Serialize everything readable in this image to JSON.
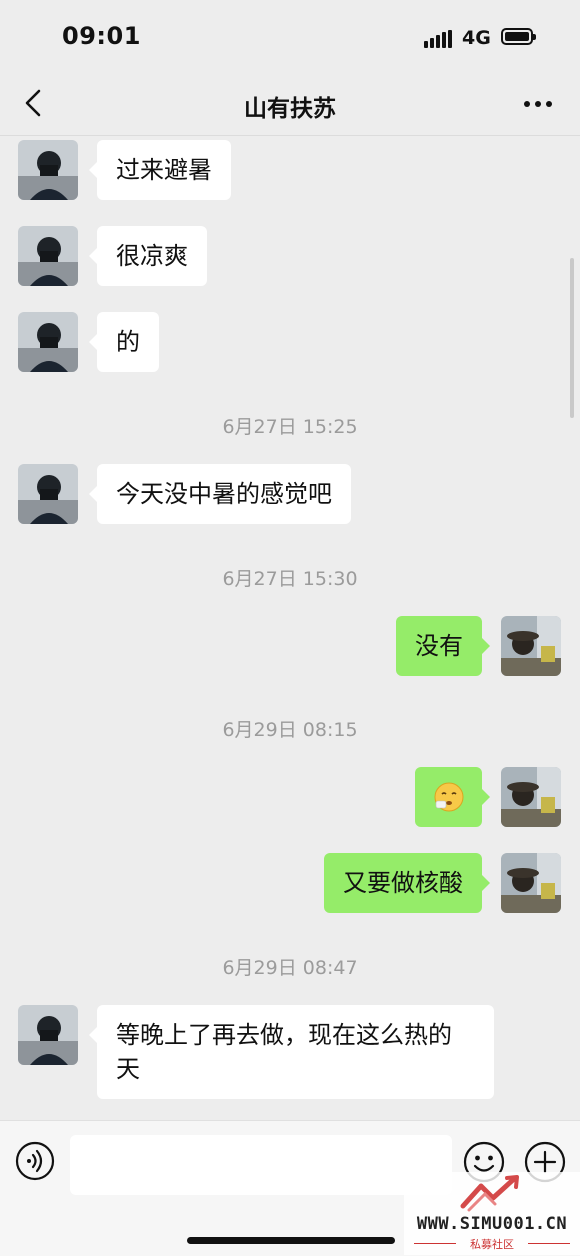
{
  "status_bar": {
    "time": "09:01",
    "network": "4G"
  },
  "header": {
    "title": "山有扶苏"
  },
  "messages": [
    {
      "side": "in",
      "text": "过来避暑"
    },
    {
      "side": "in",
      "text": "很凉爽"
    },
    {
      "side": "in",
      "text": "的"
    },
    {
      "type": "timestamp",
      "text": "6月27日 15:25"
    },
    {
      "side": "in",
      "text": "今天没中暑的感觉吧"
    },
    {
      "type": "timestamp",
      "text": "6月27日 15:30"
    },
    {
      "side": "out",
      "text": "没有"
    },
    {
      "type": "timestamp",
      "text": "6月29日 08:15"
    },
    {
      "side": "out",
      "type": "sticker",
      "emoji": "🤥"
    },
    {
      "side": "out",
      "text": "又要做核酸"
    },
    {
      "type": "timestamp",
      "text": "6月29日 08:47"
    },
    {
      "side": "in",
      "text": "等晚上了再去做，现在这么热的天"
    }
  ],
  "input_bar": {
    "value": "",
    "placeholder": ""
  },
  "watermark": {
    "text": "WWW.SIMU001.CN",
    "subtext": "私募社区"
  },
  "colors": {
    "background": "#ededed",
    "incoming_bubble": "#ffffff",
    "outgoing_bubble": "#95ec69",
    "timestamp": "#9b9b9b"
  },
  "icons": [
    "chevron-left-icon",
    "more-dots-icon",
    "voice-icon",
    "emoji-icon",
    "plus-icon"
  ]
}
